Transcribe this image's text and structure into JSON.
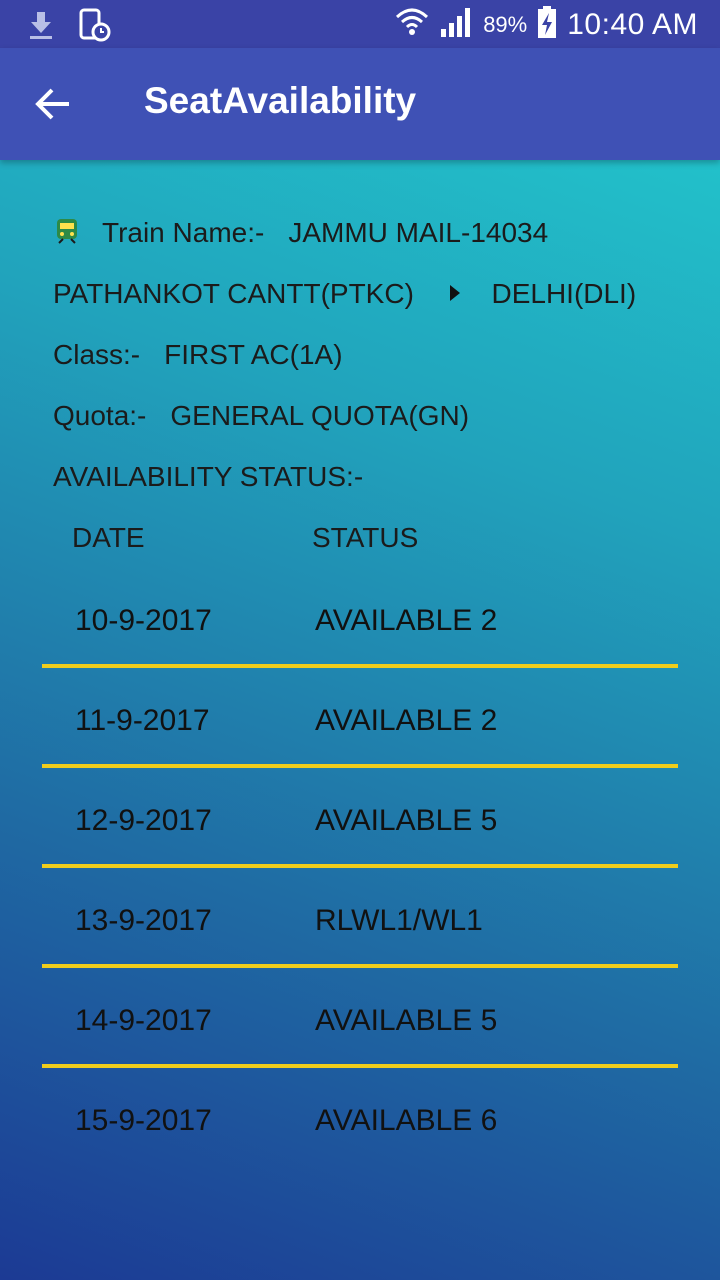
{
  "status_bar": {
    "battery_pct": "89%",
    "time": "10:40 AM"
  },
  "app_bar": {
    "title": "SeatAvailability"
  },
  "train": {
    "label": "Train Name:-",
    "name": "JAMMU MAIL-14034",
    "from": "PATHANKOT CANTT(PTKC)",
    "to": "DELHI(DLI)"
  },
  "class_info": {
    "label": "Class:-",
    "value": "FIRST AC(1A)"
  },
  "quota_info": {
    "label": "Quota:-",
    "value": "GENERAL QUOTA(GN)"
  },
  "availability_label": "AVAILABILITY STATUS:-",
  "table": {
    "headers": {
      "date": "DATE",
      "status": "STATUS"
    },
    "rows": [
      {
        "date": "10-9-2017",
        "status": "AVAILABLE 2"
      },
      {
        "date": "11-9-2017",
        "status": "AVAILABLE 2"
      },
      {
        "date": "12-9-2017",
        "status": "AVAILABLE 5"
      },
      {
        "date": "13-9-2017",
        "status": "RLWL1/WL1"
      },
      {
        "date": "14-9-2017",
        "status": "AVAILABLE 5"
      },
      {
        "date": "15-9-2017",
        "status": "AVAILABLE 6"
      }
    ]
  },
  "colors": {
    "app_bar": "#3f51b5",
    "status_bar": "#3a43a6",
    "divider": "#f0cd1c"
  }
}
